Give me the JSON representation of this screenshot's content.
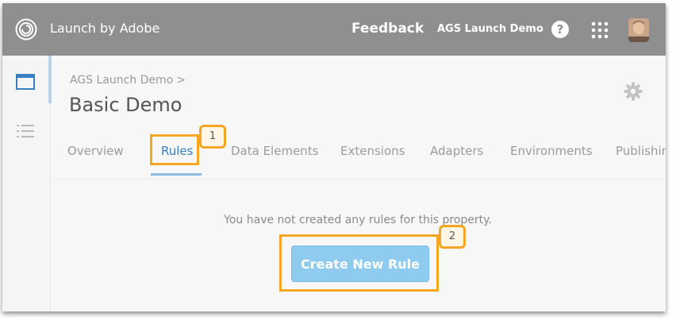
{
  "header": {
    "app_title": "Launch by Adobe",
    "feedback_label": "Feedback",
    "org_name": "AGS Launch Demo",
    "help_label": "?"
  },
  "icons": {
    "logo": "adobe-launch-logo-icon",
    "help": "help-icon",
    "apps": "app-grid-icon",
    "avatar": "user-avatar",
    "sidebar": [
      "properties-icon",
      "list-icon"
    ],
    "settings": "gear-icon"
  },
  "property": {
    "breadcrumb": "AGS Launch Demo",
    "breadcrumb_separator": ">",
    "title": "Basic Demo"
  },
  "tabs": [
    {
      "label": "Overview",
      "active": false
    },
    {
      "label": "Rules",
      "active": true
    },
    {
      "label": "Data Elements",
      "active": false
    },
    {
      "label": "Extensions",
      "active": false
    },
    {
      "label": "Adapters",
      "active": false
    },
    {
      "label": "Environments",
      "active": false
    },
    {
      "label": "Publishing",
      "active": false
    }
  ],
  "main": {
    "empty_message": "You have not created any rules for this property.",
    "create_button_label": "Create New Rule"
  },
  "callouts": [
    {
      "number": "1"
    },
    {
      "number": "2"
    }
  ],
  "colors": {
    "header_bg": "#8f8f8f",
    "accent": "#3a7fc1",
    "button_bg": "#8fcbef",
    "callout": "#f5a623"
  }
}
